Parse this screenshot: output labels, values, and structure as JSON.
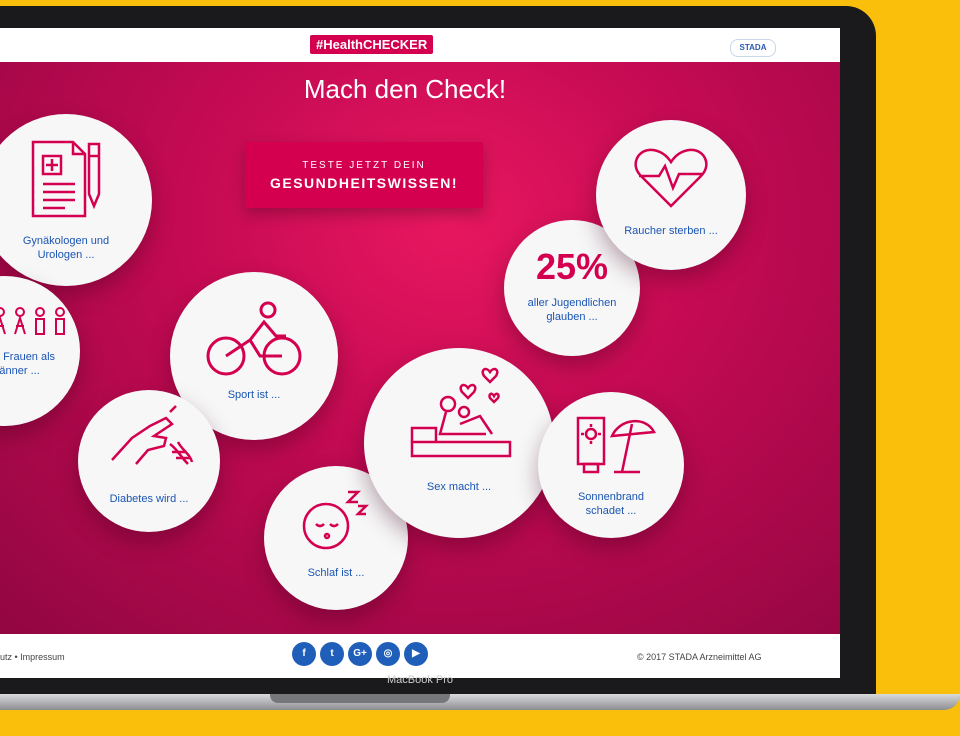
{
  "header": {
    "hashtag": "#HealthCHECKER",
    "brand": "STADA"
  },
  "hero": {
    "title": "Mach den Check!",
    "cta_line1": "TESTE JETZT DEIN",
    "cta_line2": "GESUNDHEITSWISSEN!"
  },
  "bubbles": {
    "gynecology": "Gynäkologen und Urologen ...",
    "women_men": "Mehr Frauen als Männer ...",
    "sport": "Sport ist ...",
    "diabetes": "Diabetes wird ...",
    "sleep": "Schlaf ist ...",
    "sex": "Sex macht ...",
    "youth_percent": "25%",
    "youth_text": "aller Jugendlichen glauben ...",
    "smokers": "Raucher sterben ...",
    "sunburn": "Sonnenbrand schadet ..."
  },
  "footer": {
    "links": "utz • Impressum",
    "copyright": "© 2017 STADA Arzneimittel AG",
    "social": [
      {
        "name": "facebook",
        "glyph": "f"
      },
      {
        "name": "twitter",
        "glyph": "t"
      },
      {
        "name": "google-plus",
        "glyph": "G+"
      },
      {
        "name": "instagram",
        "glyph": "◎"
      },
      {
        "name": "youtube",
        "glyph": "▶"
      }
    ]
  },
  "device_label": "MacBook Pro",
  "colors": {
    "accent": "#d4004f",
    "label_blue": "#1a55b3",
    "social_blue": "#1f5fb9",
    "background": "#f9bf0b"
  }
}
